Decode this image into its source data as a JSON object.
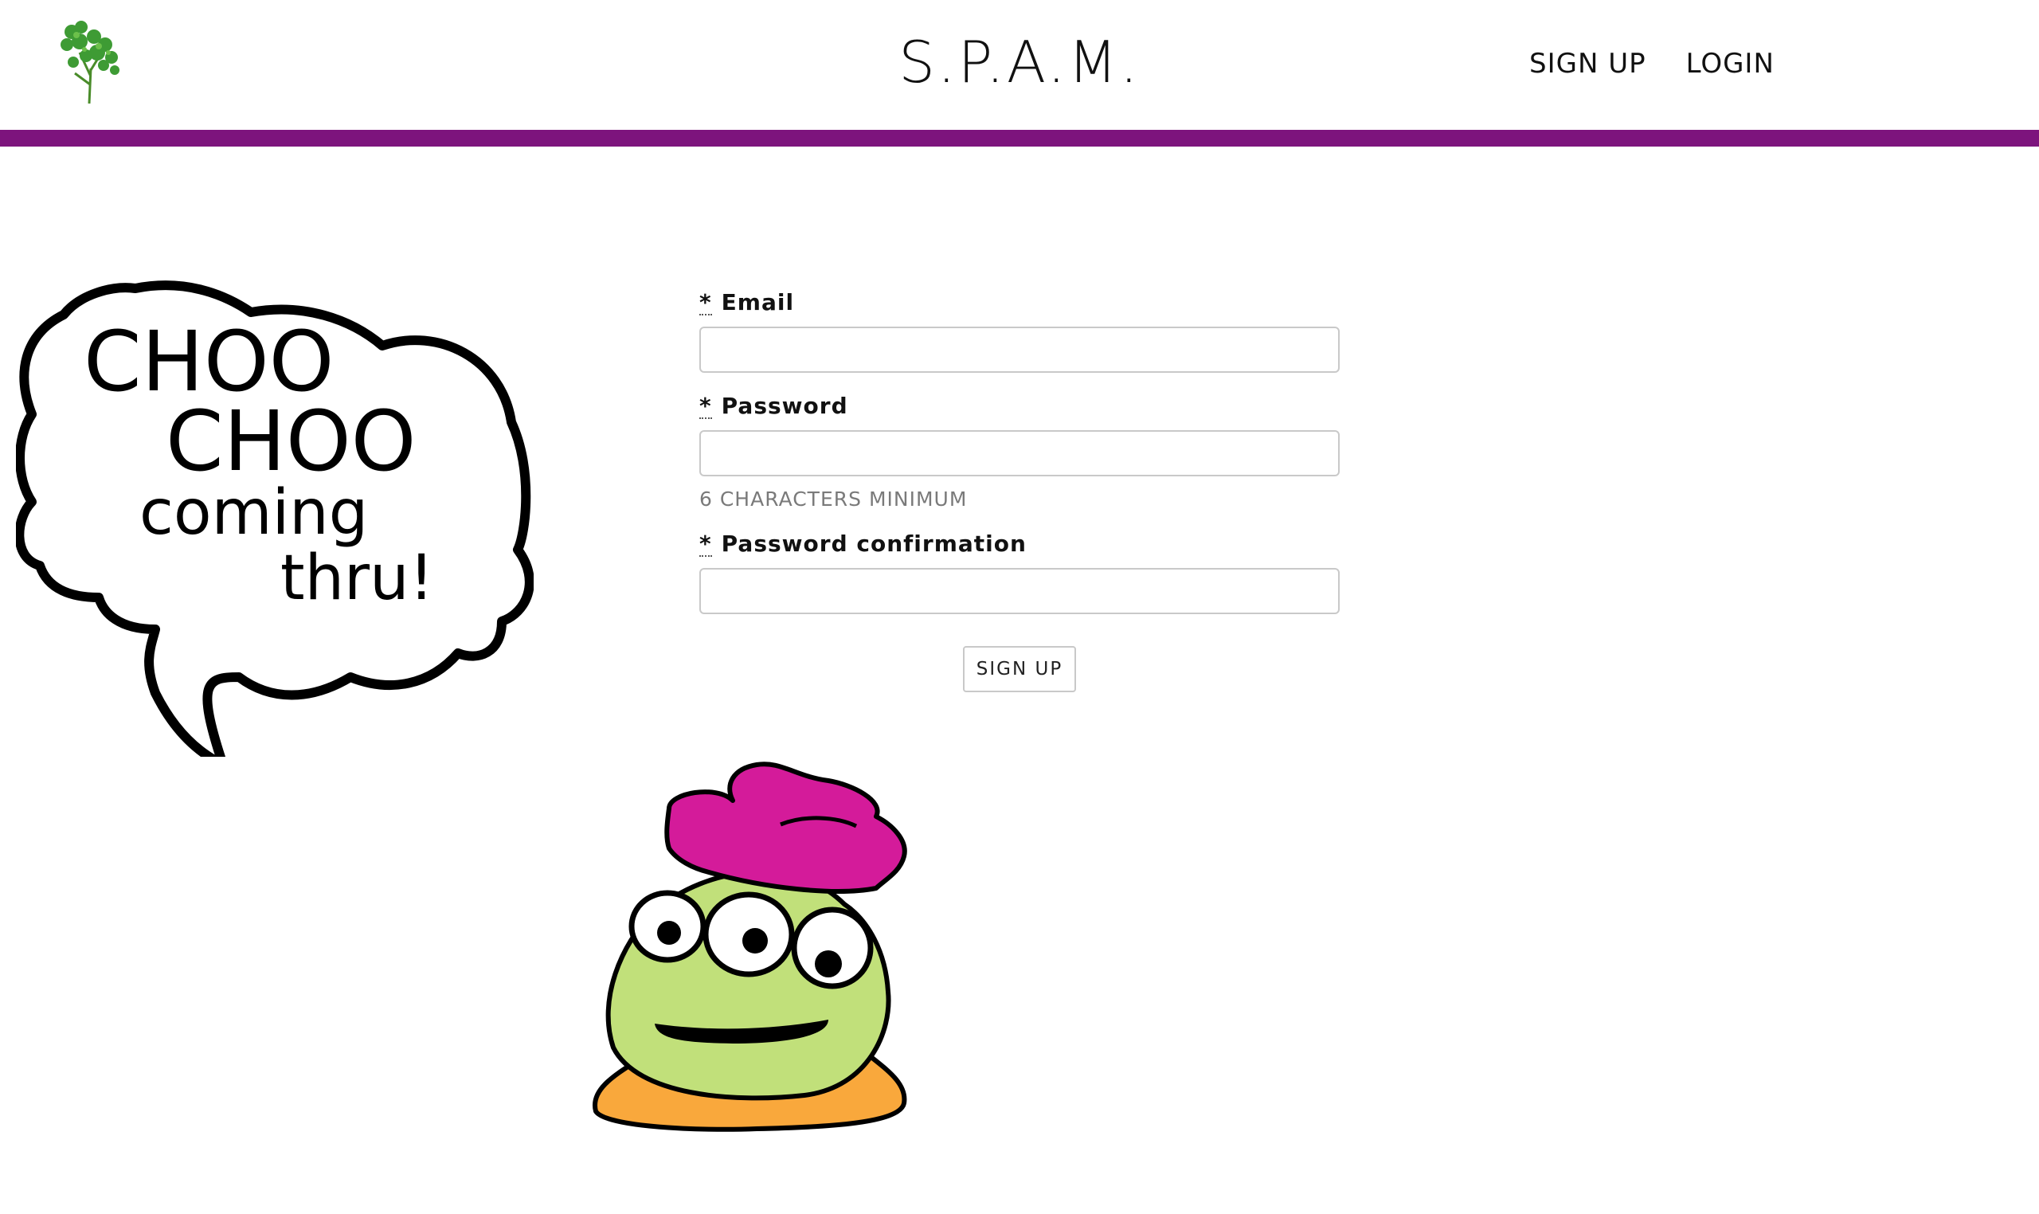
{
  "header": {
    "logo_icon": "cilantro-logo-icon",
    "title": "S.P.A.M.",
    "nav": [
      {
        "label": "SIGN UP"
      },
      {
        "label": "LOGIN"
      }
    ],
    "accent_color": "#7d147d"
  },
  "bubble": {
    "lines": [
      "CHOO",
      "CHOO",
      "coming",
      "thru!"
    ]
  },
  "form": {
    "fields": [
      {
        "required_mark": "*",
        "label": "Email",
        "value": "",
        "placeholder": ""
      },
      {
        "required_mark": "*",
        "label": "Password",
        "value": "",
        "placeholder": "",
        "hint": "6 CHARACTERS MINIMUM"
      },
      {
        "required_mark": "*",
        "label": "Password confirmation",
        "value": "",
        "placeholder": ""
      }
    ],
    "submit_label": "SIGN UP"
  },
  "mascot": {
    "icon": "green-blob-mascot-icon",
    "colors": {
      "body": "#c1e07a",
      "hat": "#d41b9a",
      "base": "#f9a83c"
    }
  }
}
